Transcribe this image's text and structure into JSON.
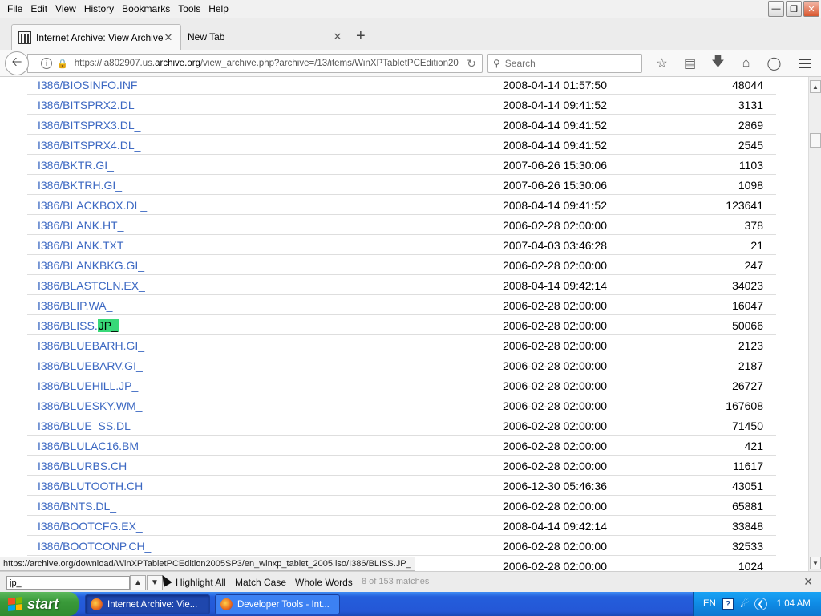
{
  "menubar": {
    "items": [
      "File",
      "Edit",
      "View",
      "History",
      "Bookmarks",
      "Tools",
      "Help"
    ]
  },
  "tabs": [
    {
      "label": "Internet Archive: View Archive",
      "active": true
    },
    {
      "label": "New Tab",
      "active": false
    }
  ],
  "navbar": {
    "url_prefix": "https://ia802907.us.",
    "url_domain": "archive.org",
    "url_suffix": "/view_archive.php?archive=/13/items/WinXPTabletPCEdition20",
    "search_placeholder": "Search"
  },
  "files": [
    {
      "name": "I386/BIOSINFO.INF",
      "date": "2008-04-14 01:57:50",
      "size": "48044"
    },
    {
      "name": "I386/BITSPRX2.DL_",
      "date": "2008-04-14 09:41:52",
      "size": "3131"
    },
    {
      "name": "I386/BITSPRX3.DL_",
      "date": "2008-04-14 09:41:52",
      "size": "2869"
    },
    {
      "name": "I386/BITSPRX4.DL_",
      "date": "2008-04-14 09:41:52",
      "size": "2545"
    },
    {
      "name": "I386/BKTR.GI_",
      "date": "2007-06-26 15:30:06",
      "size": "1103"
    },
    {
      "name": "I386/BKTRH.GI_",
      "date": "2007-06-26 15:30:06",
      "size": "1098"
    },
    {
      "name": "I386/BLACKBOX.DL_",
      "date": "2008-04-14 09:41:52",
      "size": "123641"
    },
    {
      "name": "I386/BLANK.HT_",
      "date": "2006-02-28 02:00:00",
      "size": "378"
    },
    {
      "name": "I386/BLANK.TXT",
      "date": "2007-04-03 03:46:28",
      "size": "21"
    },
    {
      "name": "I386/BLANKBKG.GI_",
      "date": "2006-02-28 02:00:00",
      "size": "247"
    },
    {
      "name": "I386/BLASTCLN.EX_",
      "date": "2008-04-14 09:42:14",
      "size": "34023"
    },
    {
      "name": "I386/BLIP.WA_",
      "date": "2006-02-28 02:00:00",
      "size": "16047"
    },
    {
      "name": "I386/BLISS.",
      "highlight": "JP_",
      "date": "2006-02-28 02:00:00",
      "size": "50066"
    },
    {
      "name": "I386/BLUEBARH.GI_",
      "date": "2006-02-28 02:00:00",
      "size": "2123"
    },
    {
      "name": "I386/BLUEBARV.GI_",
      "date": "2006-02-28 02:00:00",
      "size": "2187"
    },
    {
      "name": "I386/BLUEHILL.JP_",
      "date": "2006-02-28 02:00:00",
      "size": "26727"
    },
    {
      "name": "I386/BLUESKY.WM_",
      "date": "2006-02-28 02:00:00",
      "size": "167608"
    },
    {
      "name": "I386/BLUE_SS.DL_",
      "date": "2006-02-28 02:00:00",
      "size": "71450"
    },
    {
      "name": "I386/BLULAC16.BM_",
      "date": "2006-02-28 02:00:00",
      "size": "421"
    },
    {
      "name": "I386/BLURBS.CH_",
      "date": "2006-02-28 02:00:00",
      "size": "11617"
    },
    {
      "name": "I386/BLUTOOTH.CH_",
      "date": "2006-12-30 05:46:36",
      "size": "43051"
    },
    {
      "name": "I386/BNTS.DL_",
      "date": "2006-02-28 02:00:00",
      "size": "65881"
    },
    {
      "name": "I386/BOOTCFG.EX_",
      "date": "2008-04-14 09:42:14",
      "size": "33848"
    },
    {
      "name": "I386/BOOTCONP.CH_",
      "date": "2006-02-28 02:00:00",
      "size": "32533"
    },
    {
      "name": "",
      "date": "2006-02-28 02:00:00",
      "size": "1024"
    }
  ],
  "status_url": "https://archive.org/download/WinXPTabletPCEdition2005SP3/en_winxp_tablet_2005.iso/I386/BLISS.JP_",
  "findbar": {
    "query": "jp_",
    "highlight_all": "Highlight All",
    "match_case": "Match Case",
    "whole_words": "Whole Words",
    "status": "8 of 153 matches"
  },
  "taskbar": {
    "start": "start",
    "tasks": [
      "Internet Archive: Vie...",
      "Developer Tools - Int..."
    ],
    "lang": "EN",
    "clock": "1:04 AM"
  },
  "colors": {
    "link": "#3c68c2",
    "find_highlight": "#38d878"
  }
}
